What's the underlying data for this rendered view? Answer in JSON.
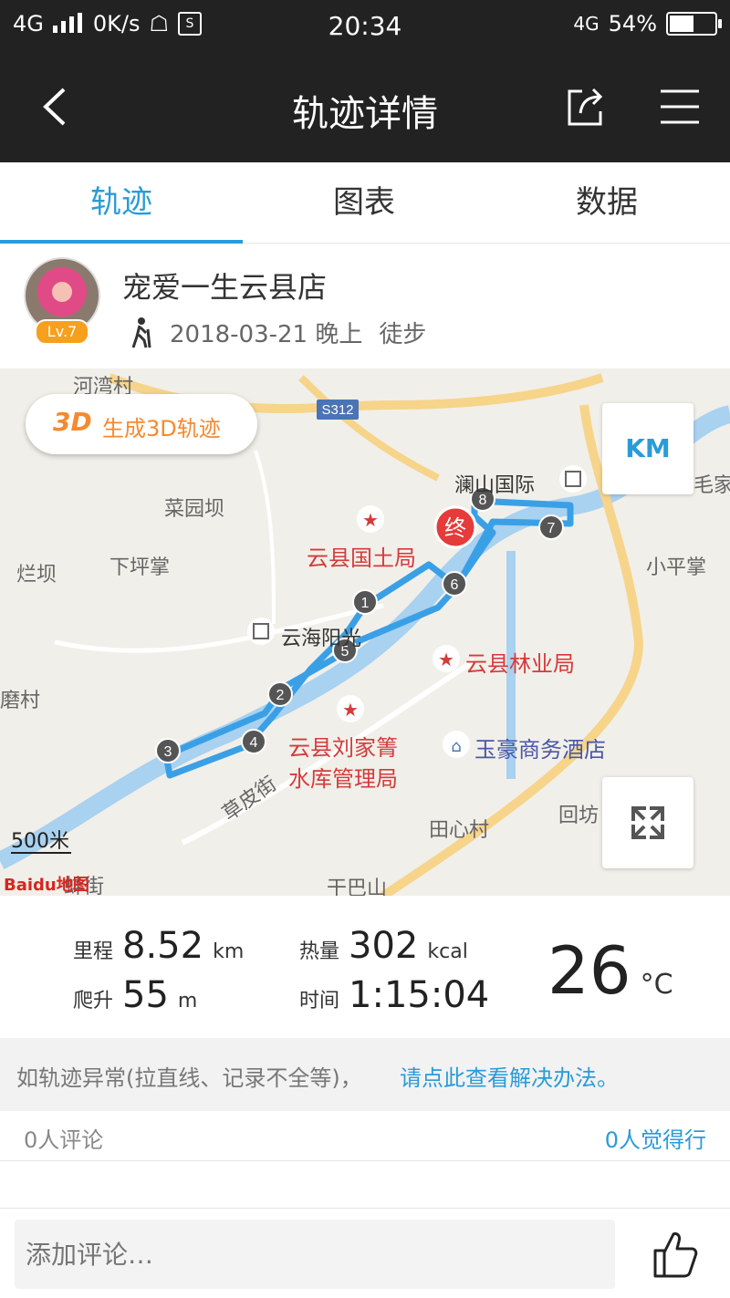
{
  "status_bar": {
    "network": "4G",
    "speed": "0K/s",
    "time": "20:34",
    "network_right": "4G",
    "battery": "54%",
    "battery_level": 0.54
  },
  "nav": {
    "title": "轨迹详情"
  },
  "tabs": [
    {
      "label": "轨迹",
      "active": true
    },
    {
      "label": "图表",
      "active": false
    },
    {
      "label": "数据",
      "active": false
    }
  ],
  "profile": {
    "name": "宠爱一生云县店",
    "level": "Lv.7",
    "datetime": "2018-03-21 晚上",
    "activity": "徒步"
  },
  "map": {
    "btn_3d_prefix": "3D",
    "btn_3d_label": "生成3D轨迹",
    "unit_button": "KM",
    "scale": "500米",
    "provider": "Baidu地图",
    "road_sign": "S312",
    "end_marker": "终",
    "waypoints": [
      "1",
      "2",
      "3",
      "4",
      "5",
      "6",
      "7",
      "8"
    ],
    "labels": {
      "hewan": "河湾村",
      "caiyuanba": "菜园坝",
      "lanba": "烂坝",
      "xiapingzhang": "下坪掌",
      "lanshan": "澜山国际",
      "jia": "毛家",
      "xiaopingzhang": "小平掌",
      "yunhai": "云海阳光",
      "moucun": "磨村",
      "caopijie": "草皮街",
      "tianxin": "田心村",
      "huifang": "回坊",
      "ganbashan": "干巴山",
      "ouxiang": "蚌街"
    },
    "pois": {
      "guotu": "云县国土局",
      "linye": "云县林业局",
      "liujia_1": "云县刘家箐",
      "liujia_2": "水库管理局",
      "hotel": "玉豪商务酒店"
    }
  },
  "stats": {
    "distance_label": "里程",
    "distance": "8.52",
    "distance_unit": "km",
    "calories_label": "热量",
    "calories": "302",
    "calories_unit": "kcal",
    "climb_label": "爬升",
    "climb": "55",
    "climb_unit": "m",
    "time_label": "时间",
    "time": "1:15:04",
    "temperature": "26",
    "temperature_unit": "°C"
  },
  "notice": {
    "text": "如轨迹异常(拉直线、记录不全等)，",
    "link": "请点此查看解决办法。"
  },
  "comments": {
    "count": "0人评论",
    "likes": "0人觉得行"
  },
  "bottom": {
    "placeholder": "添加评论…"
  },
  "colors": {
    "accent": "#2a9bd8",
    "temp": "#e53b3b",
    "orange": "#f58a2f",
    "track": "#3aa0e6"
  }
}
